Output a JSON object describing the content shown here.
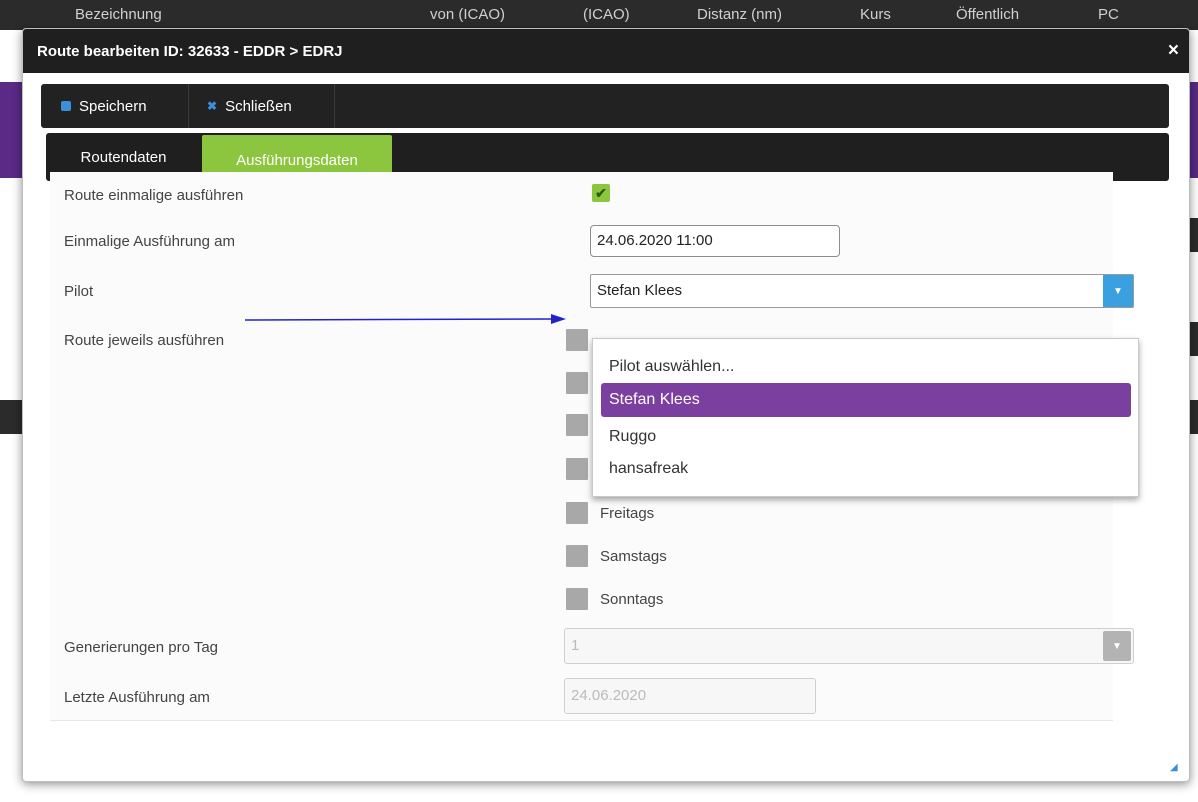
{
  "background_header": {
    "col1": "Bezeichnung",
    "col2": "von (ICAO)",
    "col3": "(ICAO)",
    "col4": "Distanz (nm)",
    "col5": "Kurs",
    "col6": "Öffentlich",
    "col7": "PC"
  },
  "dialog": {
    "title": "Route bearbeiten ID: 32633 - EDDR > EDRJ",
    "close_icon": "×"
  },
  "toolbar": {
    "save_label": "Speichern",
    "close_label": "Schließen"
  },
  "tabs": [
    {
      "label": "Routendaten"
    },
    {
      "label": "Ausführungsdaten"
    }
  ],
  "form": {
    "route_once_label": "Route einmalige ausführen",
    "route_once_checked": true,
    "once_date_label": "Einmalige Ausführung am",
    "once_date_value": "24.06.2020 11:00",
    "pilot_label": "Pilot",
    "pilot_value": "Stefan Klees",
    "route_each_label": "Route jeweils ausführen",
    "days": [
      "Freitags",
      "Samstags",
      "Sonntags"
    ],
    "generations_label": "Generierungen pro Tag",
    "generations_value": "1",
    "last_exec_label": "Letzte Ausführung am",
    "last_exec_value": "24.06.2020"
  },
  "pilot_dropdown": {
    "options": [
      "Pilot auswählen...",
      "Stefan Klees",
      "Ruggo",
      "hansafreak"
    ],
    "selected": "Stefan Klees"
  },
  "colors": {
    "accent_green": "#8cc63f",
    "selected_purple": "#7b3fa0",
    "select_arrow_blue": "#3aa0e0",
    "annotation_arrow": "#2222cc"
  }
}
